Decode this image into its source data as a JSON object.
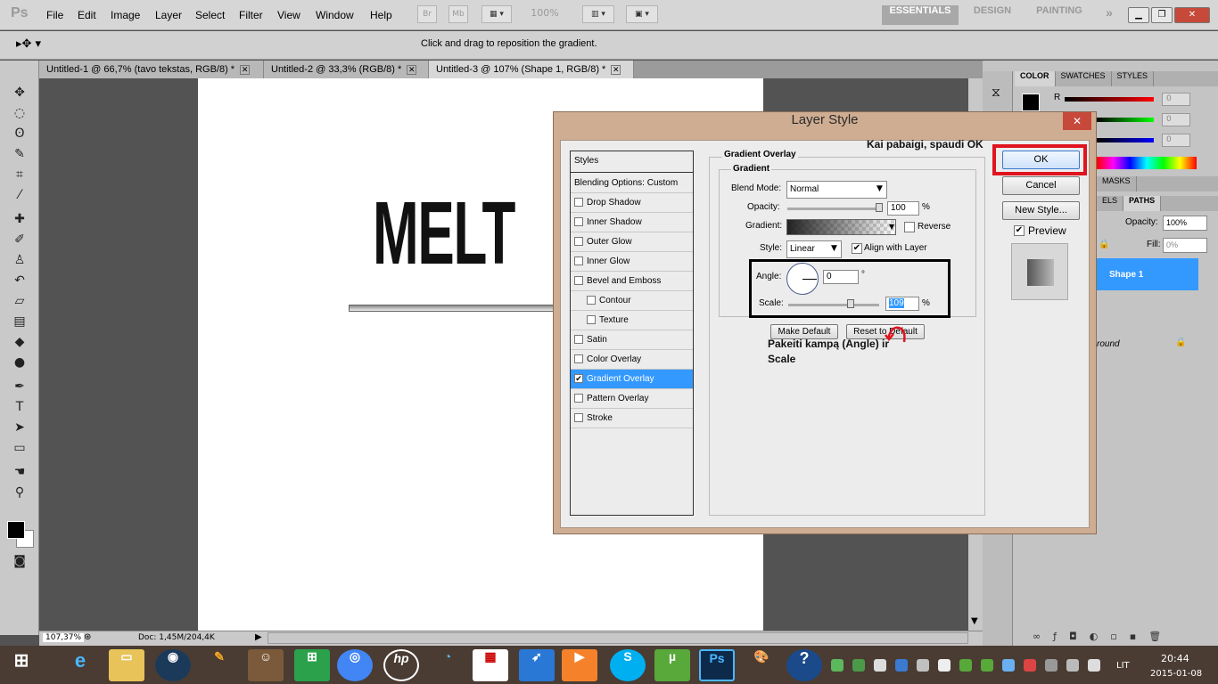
{
  "app": {
    "logo": "Ps"
  },
  "menu": [
    "File",
    "Edit",
    "Image",
    "Layer",
    "Select",
    "Filter",
    "View",
    "Window",
    "Help"
  ],
  "appbar": {
    "bridge": "Br",
    "minibridge": "Mb",
    "zoom": "100%"
  },
  "workspaces": [
    "ESSENTIALS",
    "DESIGN",
    "PAINTING"
  ],
  "options": {
    "hint": "Click and drag to reposition the gradient."
  },
  "tabs": [
    {
      "label": "Untitled-1 @ 66,7% (tavo tekstas, RGB/8) *"
    },
    {
      "label": "Untitled-2 @ 33,3% (RGB/8) *"
    },
    {
      "label": "Untitled-3 @ 107% (Shape 1, RGB/8) *"
    }
  ],
  "canvas": {
    "text": "MELT"
  },
  "status": {
    "zoom": "107,37%",
    "doc": "Doc: 1,45M/204,4K"
  },
  "color_panel": {
    "tabs": [
      "COLOR",
      "SWATCHES",
      "STYLES"
    ],
    "channels": [
      {
        "label": "R",
        "value": "0"
      },
      {
        "label": "G",
        "value": "0"
      },
      {
        "label": "B",
        "value": "0"
      }
    ]
  },
  "layers_panel": {
    "tabs": [
      "MASKS",
      "ELS",
      "PATHS"
    ],
    "opacity_label": "Opacity:",
    "opacity": "100%",
    "fill_label": "Fill:",
    "fill": "0%",
    "layer_name": "Shape 1",
    "bg_partial": "round"
  },
  "dialog": {
    "title": "Layer Style",
    "close": "✕",
    "styles_header": "Styles",
    "blending": "Blending Options: Custom",
    "items": [
      {
        "label": "Drop Shadow",
        "checked": ""
      },
      {
        "label": "Inner Shadow",
        "checked": ""
      },
      {
        "label": "Outer Glow",
        "checked": ""
      },
      {
        "label": "Inner Glow",
        "checked": ""
      },
      {
        "label": "Bevel and Emboss",
        "checked": ""
      },
      {
        "label": "Contour",
        "checked": ""
      },
      {
        "label": "Texture",
        "checked": ""
      },
      {
        "label": "Satin",
        "checked": ""
      },
      {
        "label": "Color Overlay",
        "checked": ""
      },
      {
        "label": "Gradient Overlay",
        "checked": "✔"
      },
      {
        "label": "Pattern Overlay",
        "checked": ""
      },
      {
        "label": "Stroke",
        "checked": ""
      }
    ],
    "group_title": "Gradient Overlay",
    "sub_title": "Gradient",
    "blend_label": "Blend Mode:",
    "blend_value": "Normal",
    "opacity_label": "Opacity:",
    "opacity_value": "100",
    "percent": "%",
    "gradient_label": "Gradient:",
    "reverse_label": "Reverse",
    "style_label": "Style:",
    "style_value": "Linear",
    "align_label": "Align with Layer",
    "angle_label": "Angle:",
    "angle_value": "0",
    "degree": "°",
    "scale_label": "Scale:",
    "scale_value": "109",
    "make_default": "Make Default",
    "reset_default": "Reset to Default",
    "ok": "OK",
    "cancel": "Cancel",
    "new_style": "New Style...",
    "preview": "Preview"
  },
  "annotations": {
    "ok_note": "Kai pabaigi, spaudi OK",
    "angle_note_1": "Pakeiti kampą (Angle) ir",
    "angle_note_2": "Scale"
  },
  "taskbar": {
    "lang": "LIT",
    "time": "20:44",
    "date": "2015-01-08"
  },
  "colors": {
    "dialog_frame": "#cfad92",
    "selection": "#3399ff",
    "highlight_red": "#e0141e"
  }
}
